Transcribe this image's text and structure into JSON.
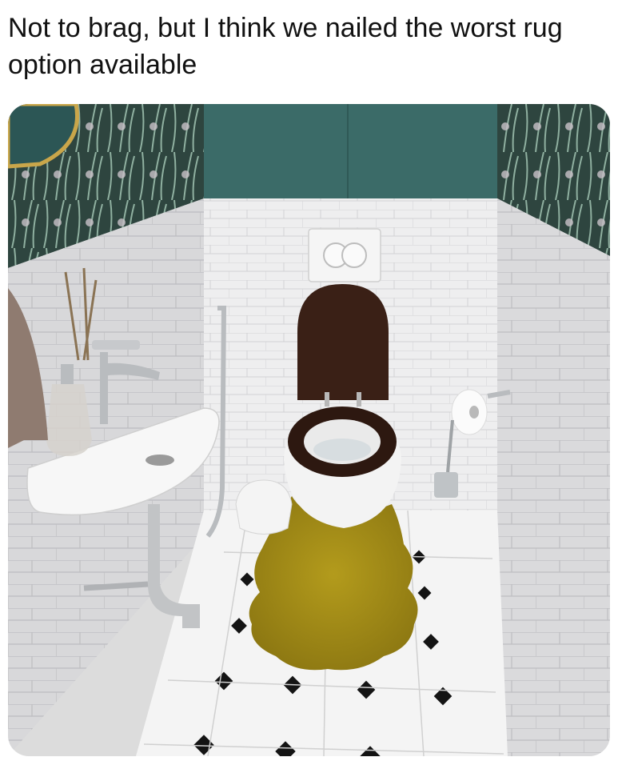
{
  "post": {
    "caption": "Not to brag, but I think we nailed the worst rug option available"
  },
  "photo": {
    "subject": "bathroom-toilet-with-yellow-rug",
    "colors": {
      "teal_cabinet": "#3a6b67",
      "wallpaper_dark": "#2f4640",
      "tile_white": "#ececec",
      "rug_mustard": "#a68f18",
      "seat_brown": "#3b2116",
      "floor_white": "#f2f2f2",
      "floor_black_inset": "#141414"
    }
  }
}
